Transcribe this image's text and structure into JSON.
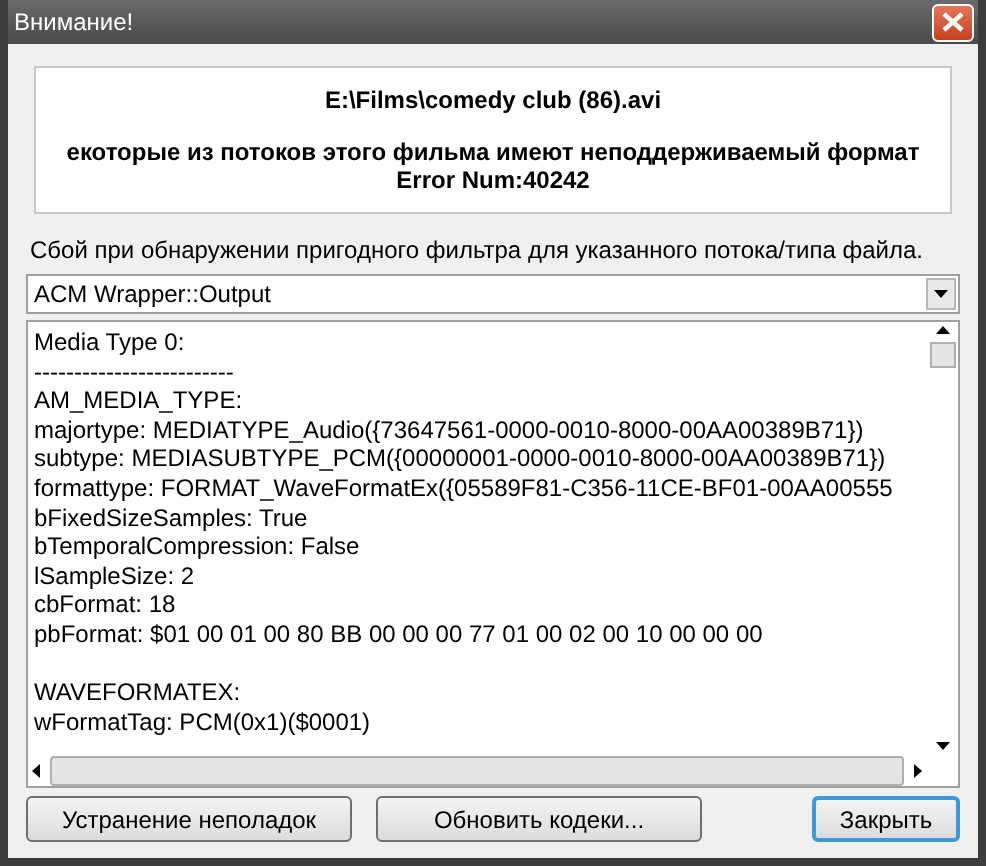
{
  "window": {
    "title": "Внимание!"
  },
  "header": {
    "file": "E:\\Films\\comedy club (86).avi",
    "message": "екоторые из потоков этого фильма имеют неподдерживаемый формат",
    "error": "Error Num:40242"
  },
  "description": "Сбой при обнаружении пригодного фильтра для указанного потока/типа файла.",
  "filter_select": {
    "value": "ACM Wrapper::Output"
  },
  "details": {
    "blocks": [
      [
        "Media Type 0:",
        "-------------------------",
        "AM_MEDIA_TYPE:",
        "majortype: MEDIATYPE_Audio({73647561-0000-0010-8000-00AA00389B71})",
        "subtype: MEDIASUBTYPE_PCM({00000001-0000-0010-8000-00AA00389B71})",
        "formattype: FORMAT_WaveFormatEx({05589F81-C356-11CE-BF01-00AA00555",
        "bFixedSizeSamples: True",
        "bTemporalCompression: False",
        "lSampleSize: 2",
        "cbFormat: 18",
        "pbFormat: $01 00 01 00 80 BB 00 00 00 77 01 00 02 00 10 00 00 00"
      ],
      [
        "WAVEFORMATEX:",
        "wFormatTag: PCM(0x1)($0001)"
      ]
    ]
  },
  "buttons": [
    {
      "label": "Устранение неполадок",
      "default": false
    },
    {
      "label": "Обновить кодеки...",
      "default": false
    },
    {
      "label": "Закрыть",
      "default": true
    }
  ]
}
